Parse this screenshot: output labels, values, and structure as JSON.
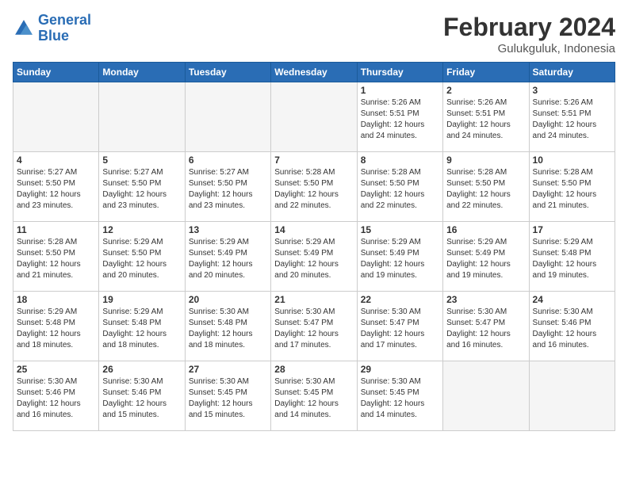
{
  "header": {
    "logo_line1": "General",
    "logo_line2": "Blue",
    "title": "February 2024",
    "subtitle": "Gulukguluk, Indonesia"
  },
  "weekdays": [
    "Sunday",
    "Monday",
    "Tuesday",
    "Wednesday",
    "Thursday",
    "Friday",
    "Saturday"
  ],
  "weeks": [
    [
      {
        "day": "",
        "info": ""
      },
      {
        "day": "",
        "info": ""
      },
      {
        "day": "",
        "info": ""
      },
      {
        "day": "",
        "info": ""
      },
      {
        "day": "1",
        "info": "Sunrise: 5:26 AM\nSunset: 5:51 PM\nDaylight: 12 hours\nand 24 minutes."
      },
      {
        "day": "2",
        "info": "Sunrise: 5:26 AM\nSunset: 5:51 PM\nDaylight: 12 hours\nand 24 minutes."
      },
      {
        "day": "3",
        "info": "Sunrise: 5:26 AM\nSunset: 5:51 PM\nDaylight: 12 hours\nand 24 minutes."
      }
    ],
    [
      {
        "day": "4",
        "info": "Sunrise: 5:27 AM\nSunset: 5:50 PM\nDaylight: 12 hours\nand 23 minutes."
      },
      {
        "day": "5",
        "info": "Sunrise: 5:27 AM\nSunset: 5:50 PM\nDaylight: 12 hours\nand 23 minutes."
      },
      {
        "day": "6",
        "info": "Sunrise: 5:27 AM\nSunset: 5:50 PM\nDaylight: 12 hours\nand 23 minutes."
      },
      {
        "day": "7",
        "info": "Sunrise: 5:28 AM\nSunset: 5:50 PM\nDaylight: 12 hours\nand 22 minutes."
      },
      {
        "day": "8",
        "info": "Sunrise: 5:28 AM\nSunset: 5:50 PM\nDaylight: 12 hours\nand 22 minutes."
      },
      {
        "day": "9",
        "info": "Sunrise: 5:28 AM\nSunset: 5:50 PM\nDaylight: 12 hours\nand 22 minutes."
      },
      {
        "day": "10",
        "info": "Sunrise: 5:28 AM\nSunset: 5:50 PM\nDaylight: 12 hours\nand 21 minutes."
      }
    ],
    [
      {
        "day": "11",
        "info": "Sunrise: 5:28 AM\nSunset: 5:50 PM\nDaylight: 12 hours\nand 21 minutes."
      },
      {
        "day": "12",
        "info": "Sunrise: 5:29 AM\nSunset: 5:50 PM\nDaylight: 12 hours\nand 20 minutes."
      },
      {
        "day": "13",
        "info": "Sunrise: 5:29 AM\nSunset: 5:49 PM\nDaylight: 12 hours\nand 20 minutes."
      },
      {
        "day": "14",
        "info": "Sunrise: 5:29 AM\nSunset: 5:49 PM\nDaylight: 12 hours\nand 20 minutes."
      },
      {
        "day": "15",
        "info": "Sunrise: 5:29 AM\nSunset: 5:49 PM\nDaylight: 12 hours\nand 19 minutes."
      },
      {
        "day": "16",
        "info": "Sunrise: 5:29 AM\nSunset: 5:49 PM\nDaylight: 12 hours\nand 19 minutes."
      },
      {
        "day": "17",
        "info": "Sunrise: 5:29 AM\nSunset: 5:48 PM\nDaylight: 12 hours\nand 19 minutes."
      }
    ],
    [
      {
        "day": "18",
        "info": "Sunrise: 5:29 AM\nSunset: 5:48 PM\nDaylight: 12 hours\nand 18 minutes."
      },
      {
        "day": "19",
        "info": "Sunrise: 5:29 AM\nSunset: 5:48 PM\nDaylight: 12 hours\nand 18 minutes."
      },
      {
        "day": "20",
        "info": "Sunrise: 5:30 AM\nSunset: 5:48 PM\nDaylight: 12 hours\nand 18 minutes."
      },
      {
        "day": "21",
        "info": "Sunrise: 5:30 AM\nSunset: 5:47 PM\nDaylight: 12 hours\nand 17 minutes."
      },
      {
        "day": "22",
        "info": "Sunrise: 5:30 AM\nSunset: 5:47 PM\nDaylight: 12 hours\nand 17 minutes."
      },
      {
        "day": "23",
        "info": "Sunrise: 5:30 AM\nSunset: 5:47 PM\nDaylight: 12 hours\nand 16 minutes."
      },
      {
        "day": "24",
        "info": "Sunrise: 5:30 AM\nSunset: 5:46 PM\nDaylight: 12 hours\nand 16 minutes."
      }
    ],
    [
      {
        "day": "25",
        "info": "Sunrise: 5:30 AM\nSunset: 5:46 PM\nDaylight: 12 hours\nand 16 minutes."
      },
      {
        "day": "26",
        "info": "Sunrise: 5:30 AM\nSunset: 5:46 PM\nDaylight: 12 hours\nand 15 minutes."
      },
      {
        "day": "27",
        "info": "Sunrise: 5:30 AM\nSunset: 5:45 PM\nDaylight: 12 hours\nand 15 minutes."
      },
      {
        "day": "28",
        "info": "Sunrise: 5:30 AM\nSunset: 5:45 PM\nDaylight: 12 hours\nand 14 minutes."
      },
      {
        "day": "29",
        "info": "Sunrise: 5:30 AM\nSunset: 5:45 PM\nDaylight: 12 hours\nand 14 minutes."
      },
      {
        "day": "",
        "info": ""
      },
      {
        "day": "",
        "info": ""
      }
    ]
  ]
}
